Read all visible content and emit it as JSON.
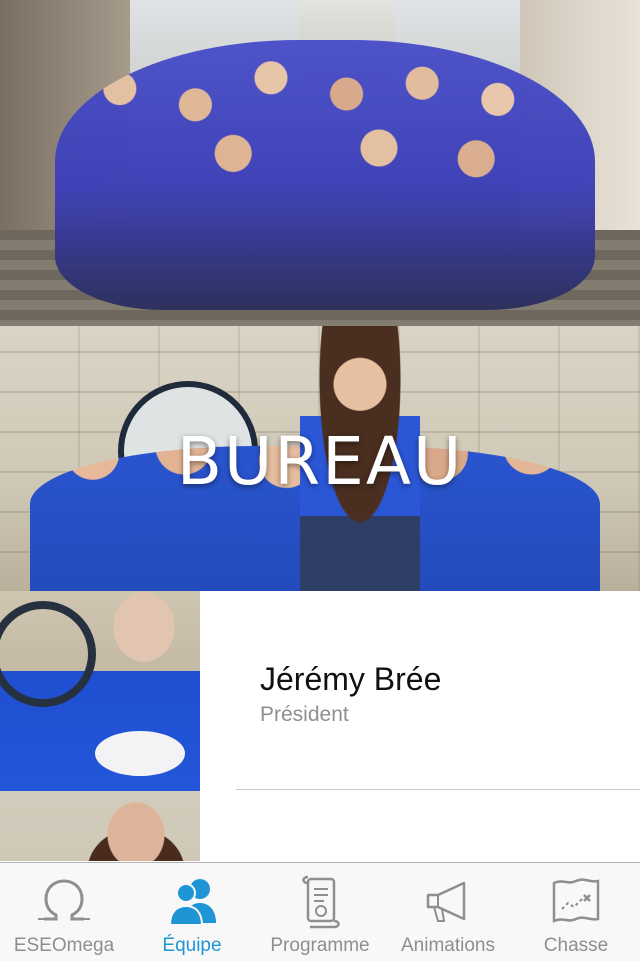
{
  "hero": {
    "shirt_color": "#3f45c6"
  },
  "bureau": {
    "title": "BUREAU"
  },
  "members": [
    {
      "name": "Jérémy Brée",
      "role": "Président"
    },
    {
      "name": "",
      "role": ""
    }
  ],
  "tabbar": {
    "accent_color": "#1f95d6",
    "inactive_color": "#8e8e93",
    "tabs": [
      {
        "label": "ESEOmega",
        "icon": "omega-icon",
        "active": false
      },
      {
        "label": "Équipe",
        "icon": "people-icon",
        "active": true
      },
      {
        "label": "Programme",
        "icon": "scroll-icon",
        "active": false
      },
      {
        "label": "Animations",
        "icon": "megaphone-icon",
        "active": false
      },
      {
        "label": "Chasse",
        "icon": "map-icon",
        "active": false
      }
    ]
  }
}
